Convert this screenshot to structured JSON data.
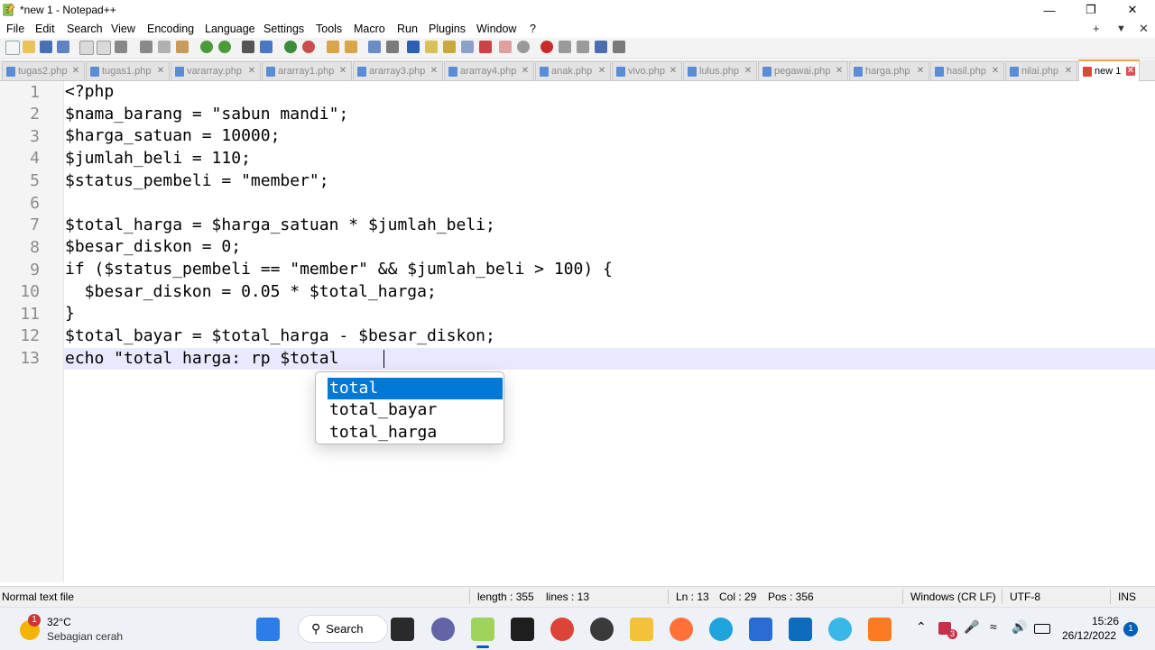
{
  "window": {
    "title": "*new 1 - Notepad++",
    "minimize": "—",
    "restore": "❐",
    "close": "✕"
  },
  "menu": {
    "items": [
      "File",
      "Edit",
      "Search",
      "View",
      "Encoding",
      "Language",
      "Settings",
      "Tools",
      "Macro",
      "Run",
      "Plugins",
      "Window",
      "?"
    ],
    "plus": "+",
    "dropdown": "▼",
    "close": "✕"
  },
  "tabs": [
    {
      "label": "tugas2.php",
      "close": "✕"
    },
    {
      "label": "tugas1.php",
      "close": "✕"
    },
    {
      "label": "vararray.php",
      "close": "✕"
    },
    {
      "label": "ararray1.php",
      "close": "✕"
    },
    {
      "label": "ararray3.php",
      "close": "✕"
    },
    {
      "label": "ararray4.php",
      "close": "✕"
    },
    {
      "label": "anak.php",
      "close": "✕"
    },
    {
      "label": "vivo.php",
      "close": "✕"
    },
    {
      "label": "lulus.php",
      "close": "✕"
    },
    {
      "label": "pegawai.php",
      "close": "✕"
    },
    {
      "label": "harga.php",
      "close": "✕"
    },
    {
      "label": "hasil.php",
      "close": "✕"
    },
    {
      "label": "nilai.php",
      "close": "✕"
    },
    {
      "label": "new 1",
      "close": "✕",
      "active": true
    }
  ],
  "editor": {
    "lines": [
      {
        "no": "1",
        "code": "<?php"
      },
      {
        "no": "2",
        "code": "$nama_barang = \"sabun mandi\";"
      },
      {
        "no": "3",
        "code": "$harga_satuan = 10000;"
      },
      {
        "no": "4",
        "code": "$jumlah_beli = 110;"
      },
      {
        "no": "5",
        "code": "$status_pembeli = \"member\";"
      },
      {
        "no": "6",
        "code": ""
      },
      {
        "no": "7",
        "code": "$total_harga = $harga_satuan * $jumlah_beli;"
      },
      {
        "no": "8",
        "code": "$besar_diskon = 0;"
      },
      {
        "no": "9",
        "code": "if ($status_pembeli == \"member\" && $jumlah_beli > 100) {"
      },
      {
        "no": "10",
        "code": "  $besar_diskon = 0.05 * $total_harga;"
      },
      {
        "no": "11",
        "code": "}"
      },
      {
        "no": "12",
        "code": "$total_bayar = $total_harga - $besar_diskon;"
      },
      {
        "no": "13",
        "code": "echo \"total harga: rp $total"
      }
    ],
    "current_line": 13
  },
  "autocomplete": {
    "items": [
      "total",
      "total_bayar",
      "total_harga"
    ],
    "selected_index": 0
  },
  "statusbar": {
    "file_type": "Normal text file",
    "length": "length : 355",
    "lines": "lines : 13",
    "ln": "Ln : 13",
    "col": "Col : 29",
    "pos": "Pos : 356",
    "eol": "Windows (CR LF)",
    "encoding": "UTF-8",
    "mode": "INS"
  },
  "taskbar": {
    "weather_temp": "32°C",
    "weather_desc": "Sebagian cerah",
    "weather_badge": "1",
    "search_label": "Search",
    "time": "15:26",
    "date": "26/12/2022",
    "notification_count": "1",
    "tray_badge": "3"
  },
  "colors": {
    "selection": "#0078d7",
    "active_tab_accent": "#f0a044",
    "current_line": "#e8e8ff"
  }
}
